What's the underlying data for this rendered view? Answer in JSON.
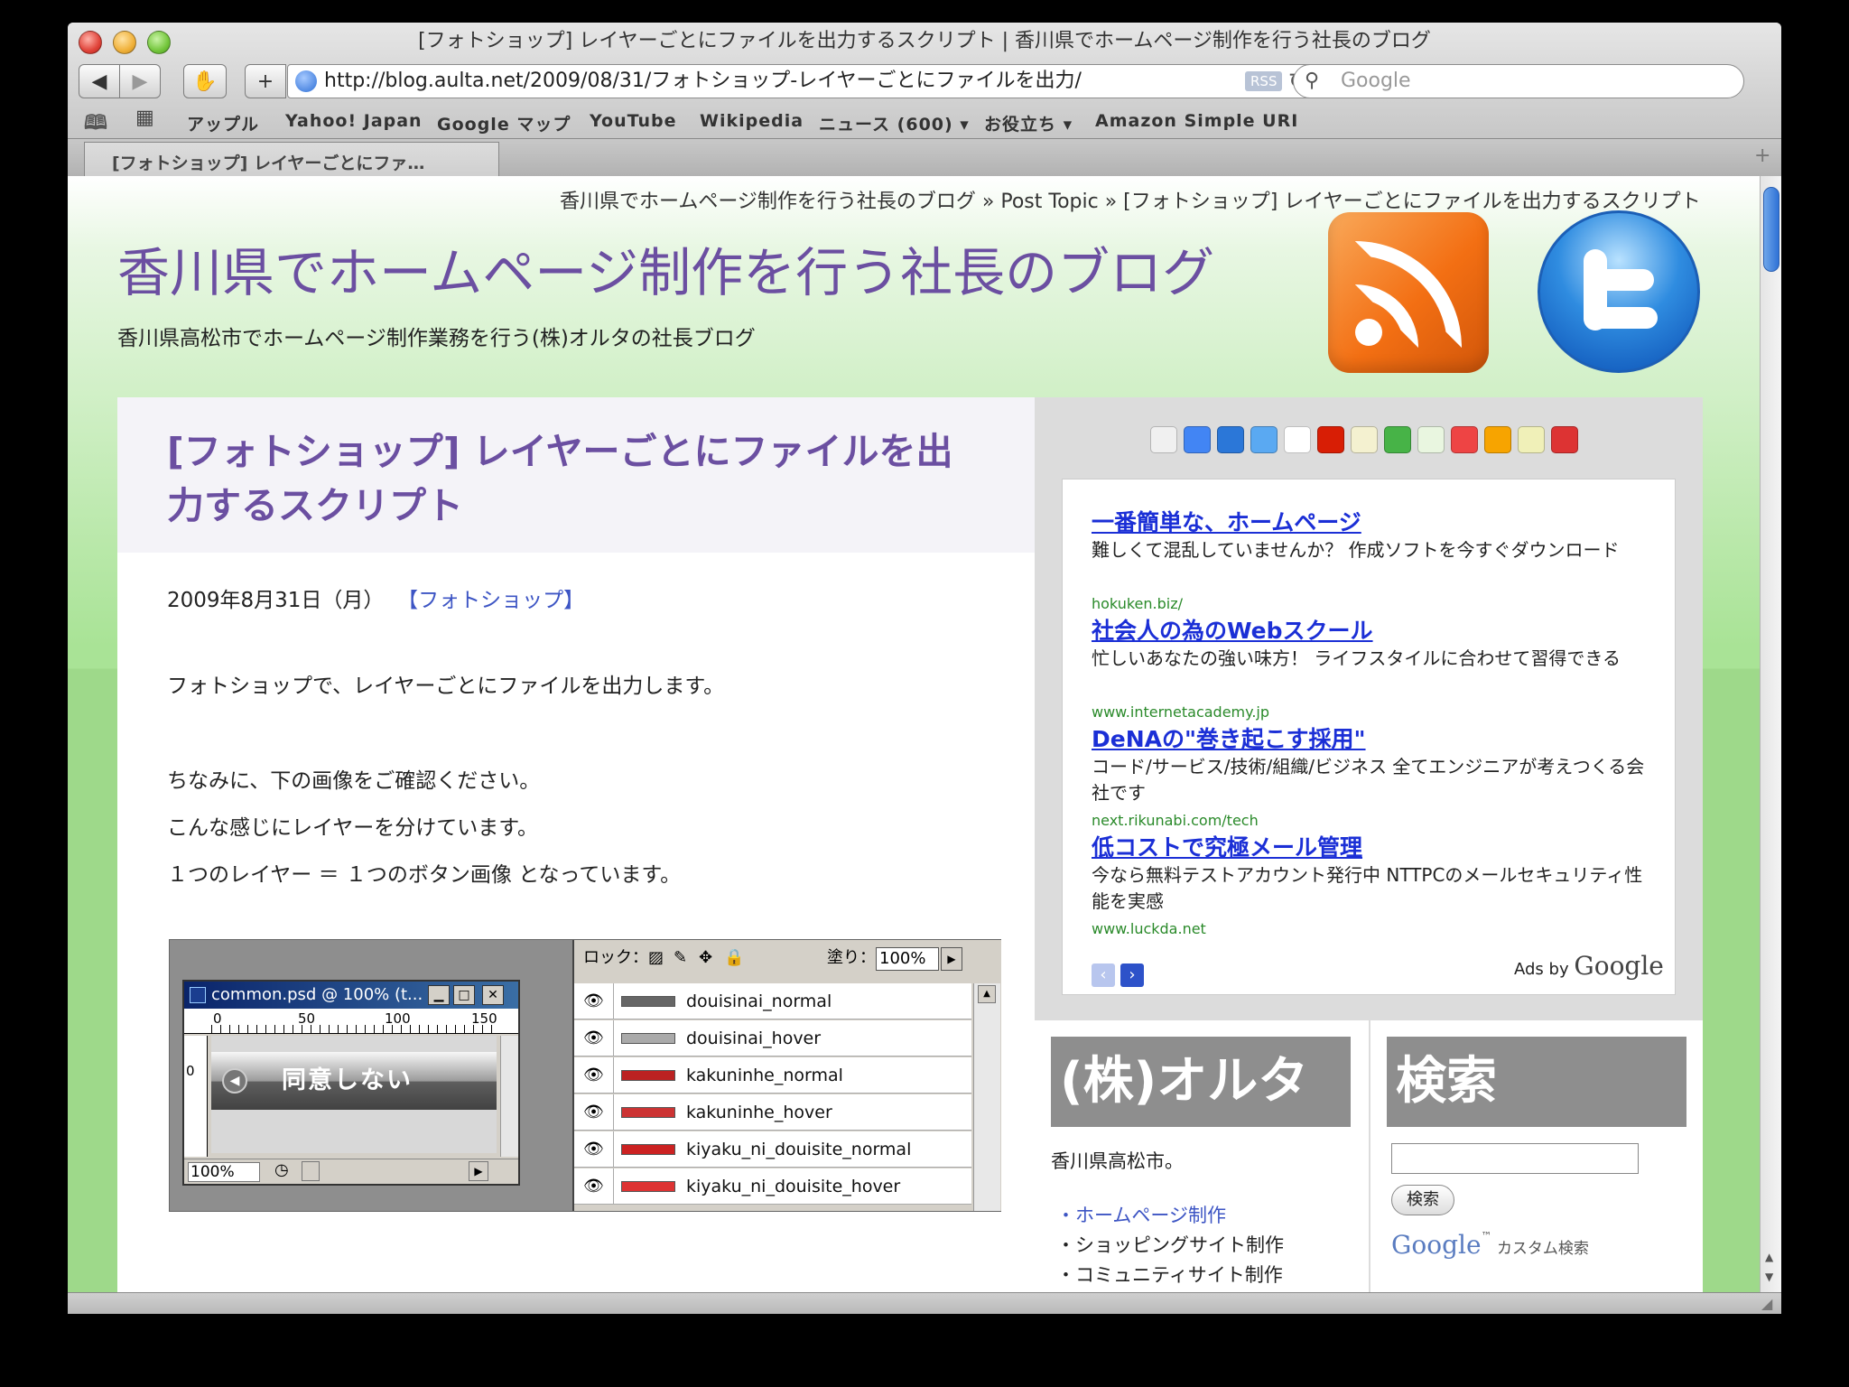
{
  "window": {
    "title": "[フォトショップ] レイヤーごとにファイルを出力するスクリプト | 香川県でホームページ制作を行う社長のブログ",
    "url": "http://blog.aulta.net/2009/08/31/フォトショップ-レイヤーごとにファイルを出力/",
    "rss_label": "RSS",
    "search_placeholder": "Google",
    "tab_label": "[フォトショップ] レイヤーごとにファ…"
  },
  "bookmarks": [
    "アップル",
    "Yahoo! Japan",
    "Google マップ",
    "YouTube",
    "Wikipedia",
    "ニュース (600) ▾",
    "お役立ち ▾",
    "Amazon Simple URI"
  ],
  "page": {
    "breadcrumb": "香川県でホームページ制作を行う社長のブログ » Post Topic » [フォトショップ] レイヤーごとにファイルを出力するスクリプト",
    "blog_title": "香川県でホームページ制作を行う社長のブログ",
    "blog_desc": "香川県高松市でホームページ制作業務を行う(株)オルタの社長ブログ",
    "post_title": "[フォトショップ] レイヤーごとにファイルを出力するスクリプト",
    "post_date": "2009年8月31日（月）",
    "post_category": "【フォトショップ】",
    "paragraphs": [
      "フォトショップで、レイヤーごとにファイルを出力します。",
      "ちなみに、下の画像をご確認ください。",
      "こんな感じにレイヤーを分けています。",
      "１つのレイヤー ＝ １つのボタン画像 となっています。"
    ]
  },
  "photoshop": {
    "doc_title": "common.psd @ 100% (t...",
    "ruler": [
      "0",
      "50",
      "100",
      "150"
    ],
    "button_text": "同意しない",
    "zoom": "100%",
    "lock_label": "ロック：",
    "fill_label": "塗り：",
    "fill_value": "100%",
    "layers": [
      "douisinai_normal",
      "douisinai_hover",
      "kakuninhe_normal",
      "kakuninhe_hover",
      "kiyaku_ni_douisite_normal",
      "kiyaku_ni_douisite_hover"
    ]
  },
  "ads": [
    {
      "title": "一番簡単な、ホームページ",
      "desc": "難しくて混乱していませんか？ 作成ソフトを今すぐダウンロード",
      "url": "hokuken.biz/"
    },
    {
      "title": "社会人の為のWebスクール",
      "desc": "忙しいあなたの強い味方！ ライフスタイルに合わせて習得できる",
      "url": "www.internetacademy.jp"
    },
    {
      "title": "DeNAの\"巻き起こす採用\"",
      "desc": "コード/サービス/技術/組織/ビジネス 全てエンジニアが考えつくる会社です",
      "url": "next.rikunabi.com/tech"
    },
    {
      "title": "低コストで究極メール管理",
      "desc": "今なら無料テストアカウント発行中 NTTPCのメールセキュリティ性能を実感",
      "url": "www.luckda.net"
    }
  ],
  "ads_by": "Ads by",
  "ads_google": "Google",
  "company": {
    "heading": "(株)オルタ",
    "location": "香川県高松市。",
    "links": [
      "・ホームページ制作",
      "・ショッピングサイト制作",
      "・コミュニティサイト制作"
    ]
  },
  "search": {
    "heading": "検索",
    "button": "検索",
    "google": "Google",
    "custom": "カスタム検索"
  },
  "colors": {
    "accent": "#6b4fa1",
    "link": "#1b2fd6",
    "green_bg": "#a9e396"
  }
}
